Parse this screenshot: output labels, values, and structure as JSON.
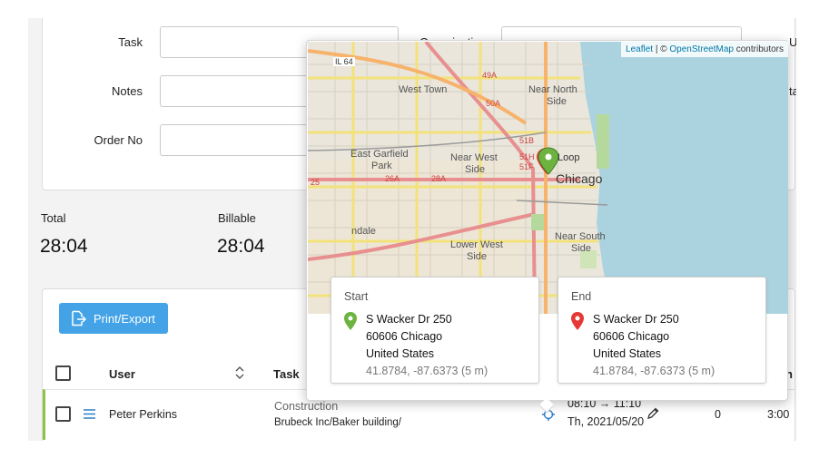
{
  "filters": {
    "task_label": "Task",
    "notes_label": "Notes",
    "order_no_label": "Order No",
    "organization_label": "Organization",
    "right_fragment_1": "U",
    "right_fragment_2": "ta"
  },
  "totals": {
    "total_label": "Total",
    "total_value": "28:04",
    "billable_label": "Billable",
    "billable_value": "28:04"
  },
  "toolbar": {
    "export_label": "Print/Export"
  },
  "table": {
    "headers": {
      "user": "User",
      "task": "Task",
      "right_fragment": "n"
    },
    "row": {
      "user": "Peter Perkins",
      "task_name": "Construction",
      "task_detail": "Brubeck Inc/Baker building/",
      "time_range": "08:10 → 11:10",
      "date": "Th, 2021/05/20",
      "count": "0",
      "duration": "3:00"
    }
  },
  "map": {
    "attribution_leaflet": "Leaflet",
    "attribution_sep": " | © ",
    "attribution_osm": "OpenStreetMap",
    "attribution_tail": " contributors",
    "labels": {
      "il64": "IL 64",
      "west_town": "West Town",
      "near_north_1": "Near North",
      "near_north_2": "Side",
      "east_garfield_1": "East Garfield",
      "east_garfield_2": "Park",
      "near_west_1": "Near West",
      "near_west_2": "Side",
      "loop": "Loop",
      "chicago": "Chicago",
      "lower_west_1": "Lower West",
      "lower_west_2": "Side",
      "near_south_1": "Near South",
      "near_south_2": "Side",
      "ndale": "ndale",
      "r49a": "49A",
      "r50a": "50A",
      "r51b": "51B",
      "r51h": "51H",
      "r51f": "51F",
      "r28a": "28A",
      "r25": "25",
      "r26a": "26A"
    },
    "start_color": "#6cb33f",
    "end_color": "#e53935"
  },
  "start": {
    "title": "Start",
    "street": "S Wacker Dr 250",
    "city": "60606 Chicago",
    "country": "United States",
    "coords": "41.8784, -87.6373 (5 m)"
  },
  "end": {
    "title": "End",
    "street": "S Wacker Dr 250",
    "city": "60606 Chicago",
    "country": "United States",
    "coords": "41.8784, -87.6373 (5 m)"
  }
}
